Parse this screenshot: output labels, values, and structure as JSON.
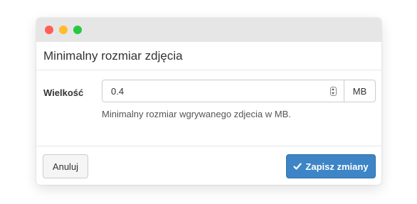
{
  "dialog": {
    "title": "Minimalny rozmiar zdjęcia"
  },
  "field": {
    "label": "Wielkość",
    "value": "0.4",
    "unit": "MB",
    "help": "Minimalny rozmiar wgrywanego zdjecia w MB."
  },
  "footer": {
    "cancel_label": "Anuluj",
    "save_label": "Zapisz zmiany"
  },
  "colors": {
    "primary": "#3d85c6",
    "close": "#ff5f57",
    "minimize": "#febc2e",
    "maximize": "#28c840"
  },
  "icons": {
    "save": "check-icon",
    "input": "spinner-icon"
  }
}
